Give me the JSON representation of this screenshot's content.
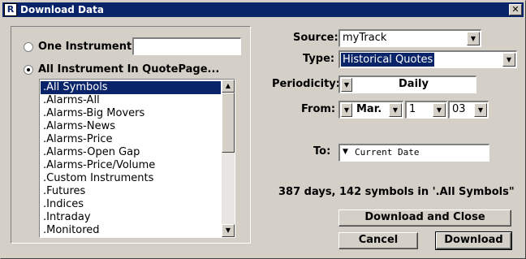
{
  "window": {
    "title": "Download Data",
    "app_icon": "R"
  },
  "left": {
    "radio_one_label": "One Instrument:",
    "one_instrument_value": "",
    "radio_all_label": "All Instrument In QuotePage...",
    "list_items": [
      ".All Symbols",
      ".Alarms-All",
      ".Alarms-Big Movers",
      ".Alarms-News",
      ".Alarms-Price",
      ".Alarms-Open Gap",
      ".Alarms-Price/Volume",
      ".Custom Instruments",
      ".Futures",
      ".Indices",
      ".Intraday",
      ".Monitored"
    ],
    "selected_item": ".All Symbols"
  },
  "right": {
    "source_label": "Source:",
    "source_value": "myTrack",
    "type_label": "Type:",
    "type_value": "Historical Quotes",
    "periodicity_label": "Periodicity:",
    "periodicity_value": "Daily",
    "from_label": "From:",
    "from_month": "Mar.",
    "from_day": "1",
    "from_year": "03",
    "to_label": "To:",
    "to_value": "Current Date",
    "status": "387 days, 142 symbols in '.All Symbols\"",
    "download_close_label": "Download and Close",
    "cancel_label": "Cancel",
    "download_label": "Download"
  }
}
